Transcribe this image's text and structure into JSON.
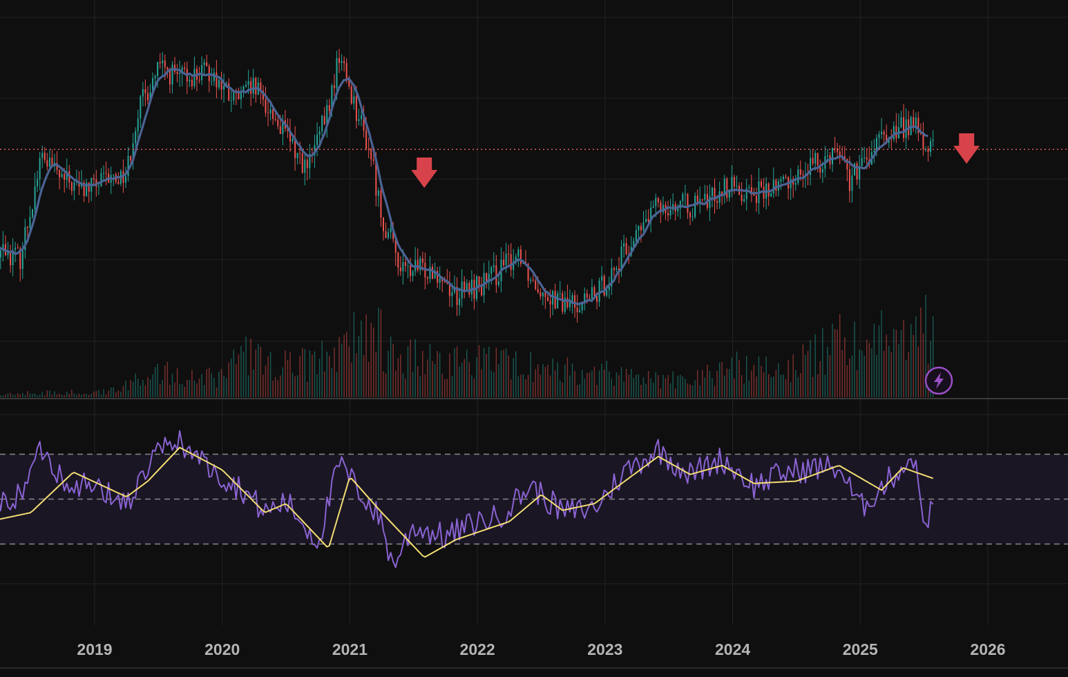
{
  "theme": {
    "background": "#0f0f0f",
    "grid": "#232323",
    "up_color": "#26a69a",
    "down_color": "#ef5350",
    "ma_color": "#4a6394",
    "rsi_color": "#8a63d2",
    "rsi_ma_color": "#f3de72",
    "rsi_band_fill": "#1a1624",
    "rsi_band_line": "#8a8a8a",
    "level_line_color": "#e25d5d",
    "sell_signal_color": "#d8434b",
    "flash_icon_color": "#9b4fc6"
  },
  "chart_data": {
    "type": "candlestick",
    "title": "",
    "xlabel": "",
    "ylabel": "",
    "x_axis": {
      "tick_labels": [
        "2019",
        "2020",
        "2021",
        "2022",
        "2023",
        "2024",
        "2025",
        "2026"
      ],
      "range": [
        "2018-03",
        "2026-06"
      ]
    },
    "price_pane": {
      "y_range_index": [
        0,
        100
      ],
      "horizontal_level": 62,
      "grid": true,
      "moving_average": true,
      "price_path_index": [
        {
          "date": "2018-03",
          "value": 34
        },
        {
          "date": "2018-06",
          "value": 30
        },
        {
          "date": "2018-08",
          "value": 60
        },
        {
          "date": "2018-10",
          "value": 53
        },
        {
          "date": "2018-12",
          "value": 50
        },
        {
          "date": "2019-04",
          "value": 55
        },
        {
          "date": "2019-05",
          "value": 73
        },
        {
          "date": "2019-07",
          "value": 86
        },
        {
          "date": "2019-09",
          "value": 83
        },
        {
          "date": "2019-12",
          "value": 85
        },
        {
          "date": "2020-02",
          "value": 76
        },
        {
          "date": "2020-04",
          "value": 80
        },
        {
          "date": "2020-06",
          "value": 71
        },
        {
          "date": "2020-09",
          "value": 56
        },
        {
          "date": "2020-11",
          "value": 74
        },
        {
          "date": "2020-12",
          "value": 90
        },
        {
          "date": "2021-03",
          "value": 60
        },
        {
          "date": "2021-04",
          "value": 42
        },
        {
          "date": "2021-06",
          "value": 26
        },
        {
          "date": "2021-09",
          "value": 27
        },
        {
          "date": "2021-11",
          "value": 19
        },
        {
          "date": "2022-02",
          "value": 23
        },
        {
          "date": "2022-05",
          "value": 32
        },
        {
          "date": "2022-06",
          "value": 24
        },
        {
          "date": "2022-09",
          "value": 16
        },
        {
          "date": "2022-12",
          "value": 18
        },
        {
          "date": "2023-03",
          "value": 32
        },
        {
          "date": "2023-06",
          "value": 46
        },
        {
          "date": "2023-10",
          "value": 45
        },
        {
          "date": "2023-12",
          "value": 51
        },
        {
          "date": "2024-04",
          "value": 49
        },
        {
          "date": "2024-09",
          "value": 58
        },
        {
          "date": "2024-11",
          "value": 63
        },
        {
          "date": "2024-12",
          "value": 53
        },
        {
          "date": "2025-01",
          "value": 56
        },
        {
          "date": "2025-03",
          "value": 65
        },
        {
          "date": "2025-06",
          "value": 70
        },
        {
          "date": "2025-07",
          "value": 63
        },
        {
          "date": "2025-08",
          "value": 62
        }
      ],
      "volume_path_index": [
        {
          "date": "2018-03",
          "value": 3
        },
        {
          "date": "2019-02",
          "value": 5
        },
        {
          "date": "2019-06",
          "value": 22
        },
        {
          "date": "2020-01",
          "value": 18
        },
        {
          "date": "2020-03",
          "value": 38
        },
        {
          "date": "2020-06",
          "value": 28
        },
        {
          "date": "2020-10",
          "value": 32
        },
        {
          "date": "2021-01",
          "value": 48
        },
        {
          "date": "2021-03",
          "value": 65
        },
        {
          "date": "2021-05",
          "value": 38
        },
        {
          "date": "2021-09",
          "value": 32
        },
        {
          "date": "2022-03",
          "value": 30
        },
        {
          "date": "2022-09",
          "value": 24
        },
        {
          "date": "2023-03",
          "value": 20
        },
        {
          "date": "2023-09",
          "value": 14
        },
        {
          "date": "2024-01",
          "value": 28
        },
        {
          "date": "2024-06",
          "value": 26
        },
        {
          "date": "2024-11",
          "value": 50
        },
        {
          "date": "2025-03",
          "value": 58
        },
        {
          "date": "2025-06",
          "value": 54
        },
        {
          "date": "2025-07",
          "value": 62
        },
        {
          "date": "2025-08",
          "value": 52
        }
      ],
      "signals": [
        {
          "type": "sell",
          "date": "2021-08"
        },
        {
          "type": "sell",
          "date": "2025-11"
        }
      ]
    },
    "rsi_pane": {
      "y_range": [
        0,
        100
      ],
      "upper_band": 70,
      "middle_band": 50,
      "lower_band": 30,
      "grid": true,
      "rsi_path": [
        {
          "date": "2018-03",
          "value": 45
        },
        {
          "date": "2018-06",
          "value": 52
        },
        {
          "date": "2018-08",
          "value": 73
        },
        {
          "date": "2018-10",
          "value": 59
        },
        {
          "date": "2019-01",
          "value": 55
        },
        {
          "date": "2019-04",
          "value": 48
        },
        {
          "date": "2019-07",
          "value": 71
        },
        {
          "date": "2019-09",
          "value": 76
        },
        {
          "date": "2019-12",
          "value": 63
        },
        {
          "date": "2020-03",
          "value": 54
        },
        {
          "date": "2020-05",
          "value": 44
        },
        {
          "date": "2020-07",
          "value": 49
        },
        {
          "date": "2020-10",
          "value": 31
        },
        {
          "date": "2020-12",
          "value": 66
        },
        {
          "date": "2021-02",
          "value": 53
        },
        {
          "date": "2021-04",
          "value": 40
        },
        {
          "date": "2021-05",
          "value": 20
        },
        {
          "date": "2021-07",
          "value": 38
        },
        {
          "date": "2021-10",
          "value": 33
        },
        {
          "date": "2022-01",
          "value": 40
        },
        {
          "date": "2022-03",
          "value": 42
        },
        {
          "date": "2022-06",
          "value": 56
        },
        {
          "date": "2022-09",
          "value": 44
        },
        {
          "date": "2022-12",
          "value": 46
        },
        {
          "date": "2023-03",
          "value": 63
        },
        {
          "date": "2023-06",
          "value": 72
        },
        {
          "date": "2023-09",
          "value": 61
        },
        {
          "date": "2023-12",
          "value": 68
        },
        {
          "date": "2024-03",
          "value": 56
        },
        {
          "date": "2024-06",
          "value": 62
        },
        {
          "date": "2024-09",
          "value": 64
        },
        {
          "date": "2024-11",
          "value": 64
        },
        {
          "date": "2025-01",
          "value": 46
        },
        {
          "date": "2025-04",
          "value": 60
        },
        {
          "date": "2025-06",
          "value": 69
        },
        {
          "date": "2025-07",
          "value": 40
        },
        {
          "date": "2025-08",
          "value": 47
        }
      ],
      "rsi_ma_path": [
        {
          "date": "2018-03",
          "value": 40
        },
        {
          "date": "2018-07",
          "value": 44
        },
        {
          "date": "2018-11",
          "value": 62
        },
        {
          "date": "2019-04",
          "value": 51
        },
        {
          "date": "2019-06",
          "value": 58
        },
        {
          "date": "2019-09",
          "value": 73
        },
        {
          "date": "2020-01",
          "value": 63
        },
        {
          "date": "2020-05",
          "value": 44
        },
        {
          "date": "2020-07",
          "value": 48
        },
        {
          "date": "2020-11",
          "value": 28
        },
        {
          "date": "2021-01",
          "value": 60
        },
        {
          "date": "2021-04",
          "value": 44
        },
        {
          "date": "2021-08",
          "value": 24
        },
        {
          "date": "2021-11",
          "value": 32
        },
        {
          "date": "2022-04",
          "value": 40
        },
        {
          "date": "2022-07",
          "value": 52
        },
        {
          "date": "2022-09",
          "value": 45
        },
        {
          "date": "2022-12",
          "value": 48
        },
        {
          "date": "2023-06",
          "value": 69
        },
        {
          "date": "2023-09",
          "value": 61
        },
        {
          "date": "2023-12",
          "value": 65
        },
        {
          "date": "2024-03",
          "value": 57
        },
        {
          "date": "2024-07",
          "value": 58
        },
        {
          "date": "2024-11",
          "value": 65
        },
        {
          "date": "2025-03",
          "value": 54
        },
        {
          "date": "2025-05",
          "value": 64
        },
        {
          "date": "2025-08",
          "value": 59
        }
      ]
    }
  },
  "icons": {
    "sell_signal": "arrow-down-icon",
    "flash": "lightning-icon"
  }
}
